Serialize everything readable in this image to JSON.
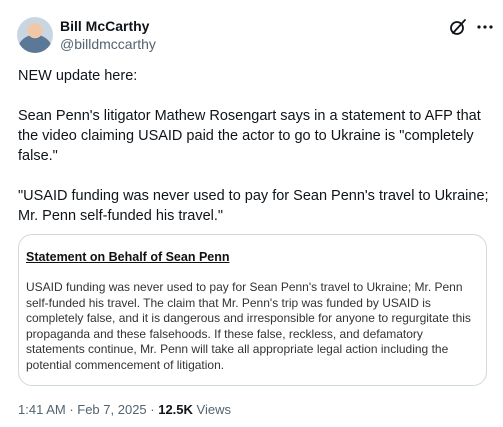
{
  "author": {
    "name": "Bill McCarthy",
    "handle": "@billdmccarthy"
  },
  "icons": {
    "grok": "grok-icon",
    "more": "more-icon"
  },
  "tweet": {
    "paragraphs": [
      "NEW update here:",
      "Sean Penn's litigator Mathew Rosengart says in a statement to AFP that the video claiming USAID paid the actor to go to Ukraine is \"completely false.\"",
      "\"USAID funding was never used to pay for Sean Penn's travel to Ukraine; Mr. Penn self-funded his travel.\""
    ]
  },
  "statement": {
    "heading": "Statement on Behalf of Sean Penn",
    "body": "USAID funding was never used to pay for Sean Penn's travel to Ukraine; Mr. Penn self-funded his travel. The claim that Mr. Penn's trip was funded by USAID is completely false, and it is dangerous and irresponsible for anyone to regurgitate this propaganda and these falsehoods. If these false, reckless, and defamatory statements continue, Mr. Penn will take all appropriate legal action including the potential commencement of litigation."
  },
  "meta": {
    "time": "1:41 AM",
    "separator": " · ",
    "date": "Feb 7, 2025",
    "views_count": "12.5K",
    "views_label": "Views"
  }
}
